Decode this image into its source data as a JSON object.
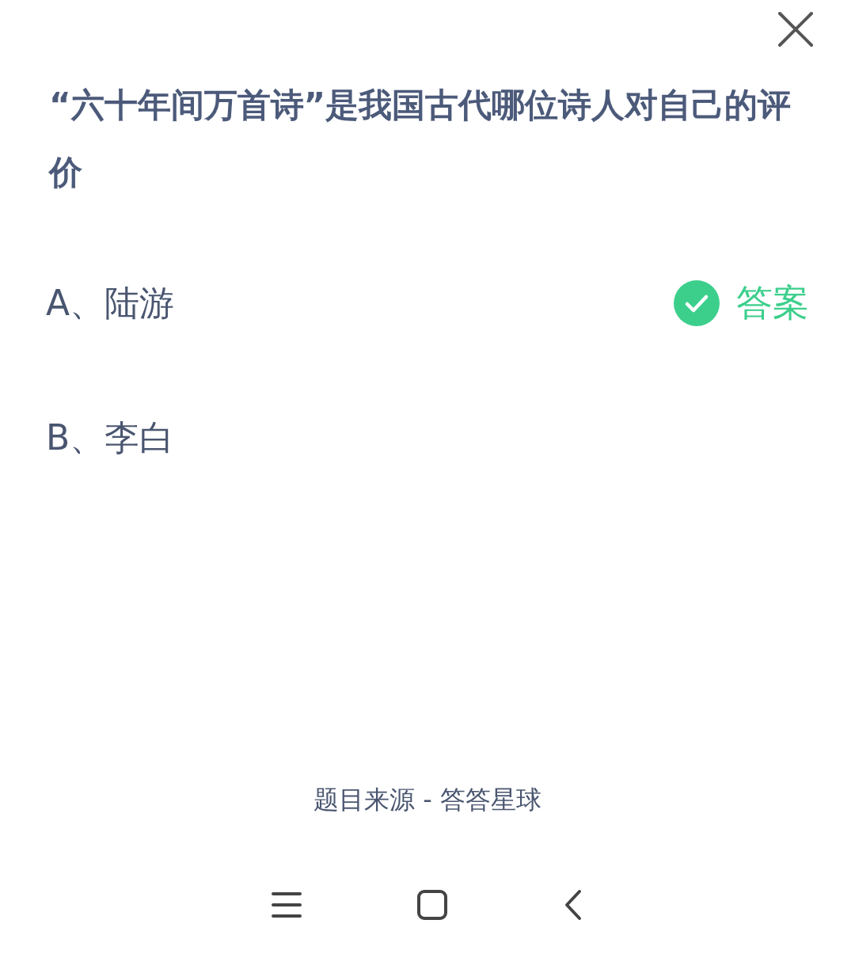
{
  "question": "“六十年间万首诗”是我国古代哪位诗人对自己的评价",
  "answer_label": "答案",
  "options": [
    {
      "text": "A、陆游",
      "correct": true
    },
    {
      "text": "B、李白",
      "correct": false
    }
  ],
  "source": "题目来源 - 答答星球"
}
